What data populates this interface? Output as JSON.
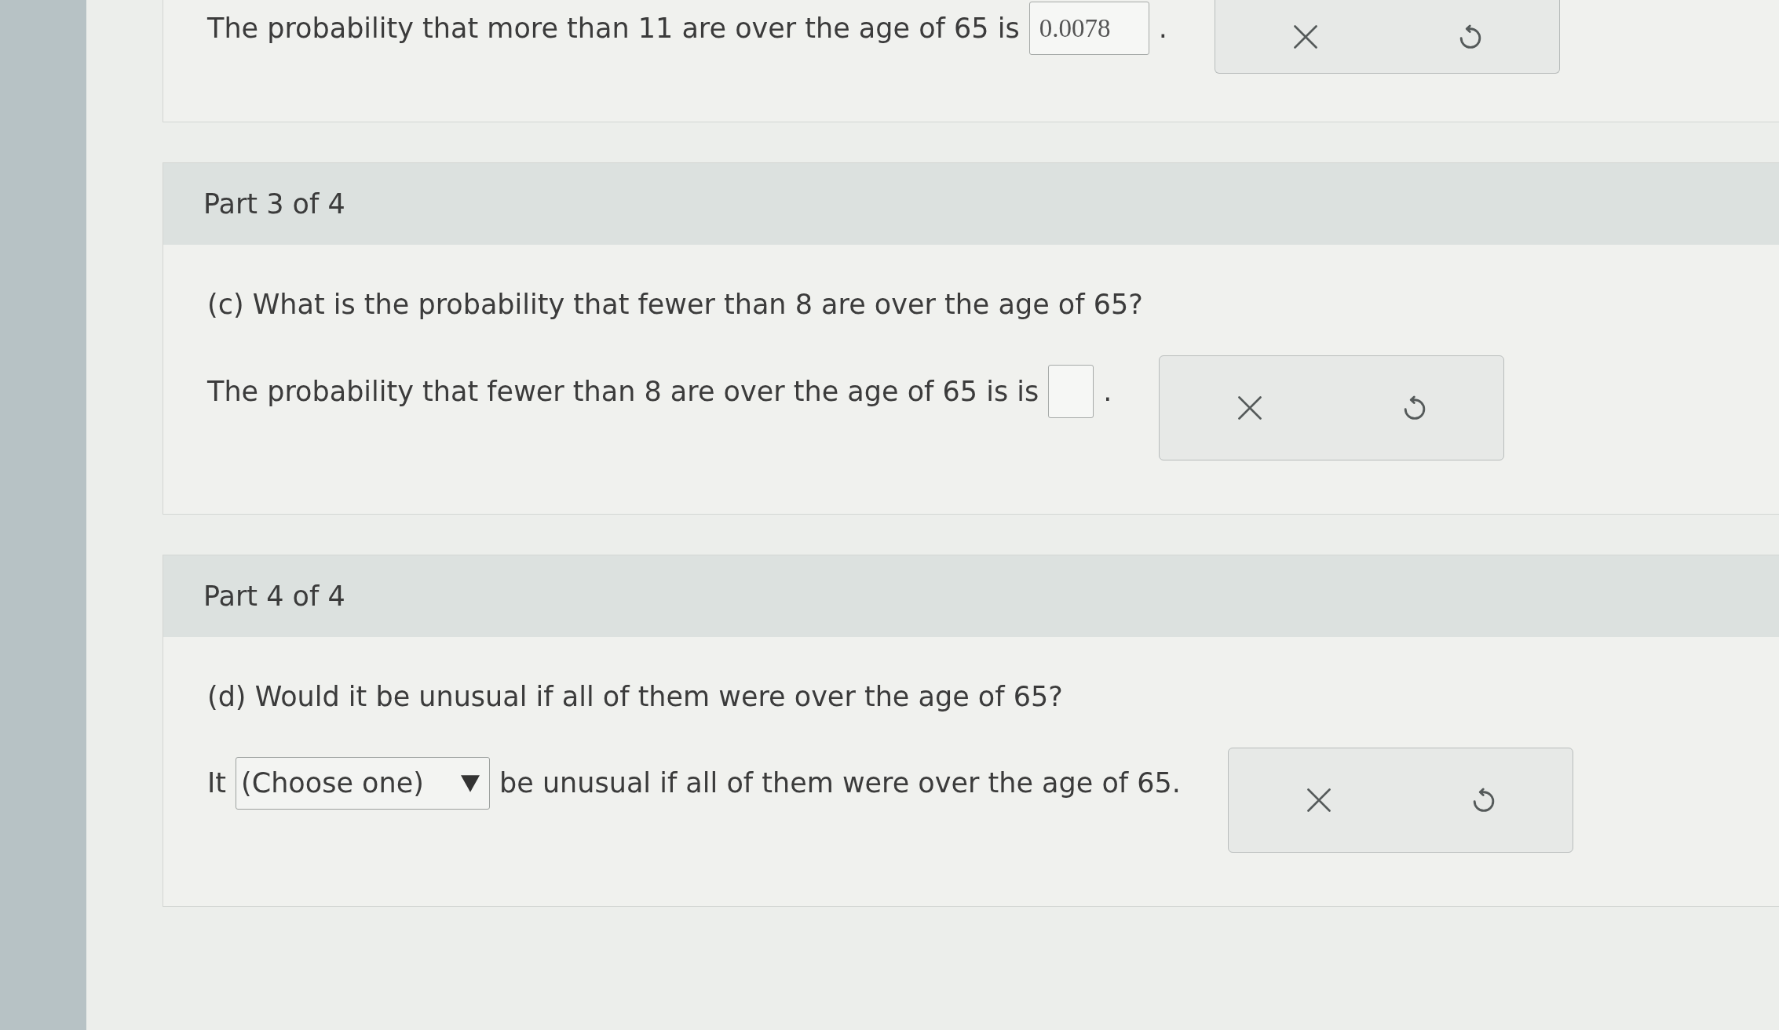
{
  "parts": [
    {
      "answer": {
        "prefix": "The probability that more than 11 are over the age of 65 is",
        "field": {
          "kind": "input",
          "value": "0.0078"
        },
        "suffix": "."
      }
    },
    {
      "header": "Part 3 of 4",
      "question": "(c) What is the probability that fewer than 8 are over the age of 65?",
      "answer": {
        "prefix": "The probability that fewer than 8 are over the age of 65 is is",
        "field": {
          "kind": "input"
        },
        "suffix": "."
      }
    },
    {
      "header": "Part 4 of 4",
      "question": "(d) Would it be unusual if all of them were over the age of 65?",
      "answer": {
        "prefix": "It",
        "field": {
          "kind": "select",
          "value": "(Choose one)"
        },
        "suffix": "be unusual if all of them were over the age of 65."
      }
    }
  ]
}
